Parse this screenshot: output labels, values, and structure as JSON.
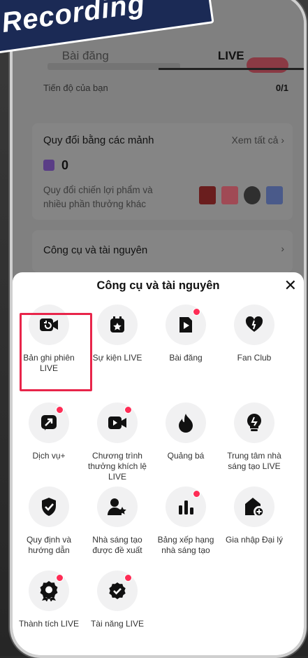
{
  "badge": {
    "text": "Recording"
  },
  "tabs": [
    {
      "label": "Bài đăng",
      "active": false
    },
    {
      "label": "LIVE",
      "active": true
    }
  ],
  "progress": {
    "label": "Tiến độ của bạn",
    "value": "0/1"
  },
  "redeem": {
    "title": "Quy đổi bằng các mảnh",
    "see_all": "Xem tất cả",
    "count": "0",
    "description": "Quy đổi chiến lợi phẩm và nhiều phần thưởng khác"
  },
  "tools_row": {
    "label": "Công cụ và tài nguyên"
  },
  "sheet": {
    "title": "Công cụ và tài nguyên",
    "close_icon": "close-icon",
    "items": [
      {
        "label": "Bản ghi phiên LIVE",
        "icon": "replay-video-icon",
        "dot": false,
        "highlighted": true
      },
      {
        "label": "Sự kiện LIVE",
        "icon": "calendar-star-icon",
        "dot": false
      },
      {
        "label": "Bài đăng",
        "icon": "post-sparkle-icon",
        "dot": true
      },
      {
        "label": "Fan Club",
        "icon": "heart-icon",
        "dot": false
      },
      {
        "label": "Dịch vụ+",
        "icon": "service-arrow-icon",
        "dot": true
      },
      {
        "label": "Chương trình thưởng khích lệ LIVE",
        "icon": "video-camera-icon",
        "dot": true
      },
      {
        "label": "Quảng bá",
        "icon": "flame-icon",
        "dot": false
      },
      {
        "label": "Trung tâm nhà sáng tạo LIVE",
        "icon": "lightbulb-icon",
        "dot": false
      },
      {
        "label": "Quy định và hướng dẫn",
        "icon": "shield-check-icon",
        "dot": false
      },
      {
        "label": "Nhà sáng tạo được đề xuất",
        "icon": "user-star-icon",
        "dot": false
      },
      {
        "label": "Bảng xếp hạng nhà sáng tạo",
        "icon": "bar-chart-icon",
        "dot": true
      },
      {
        "label": "Gia nhập Đại lý",
        "icon": "house-plus-icon",
        "dot": false
      },
      {
        "label": "Thành tích LIVE",
        "icon": "medal-icon",
        "dot": true
      },
      {
        "label": "Tài năng LIVE",
        "icon": "verified-badge-icon",
        "dot": true
      }
    ]
  },
  "colors": {
    "accent": "#fe2c55",
    "highlight_border": "#e8254a",
    "badge_bg": "#1b2a55"
  }
}
